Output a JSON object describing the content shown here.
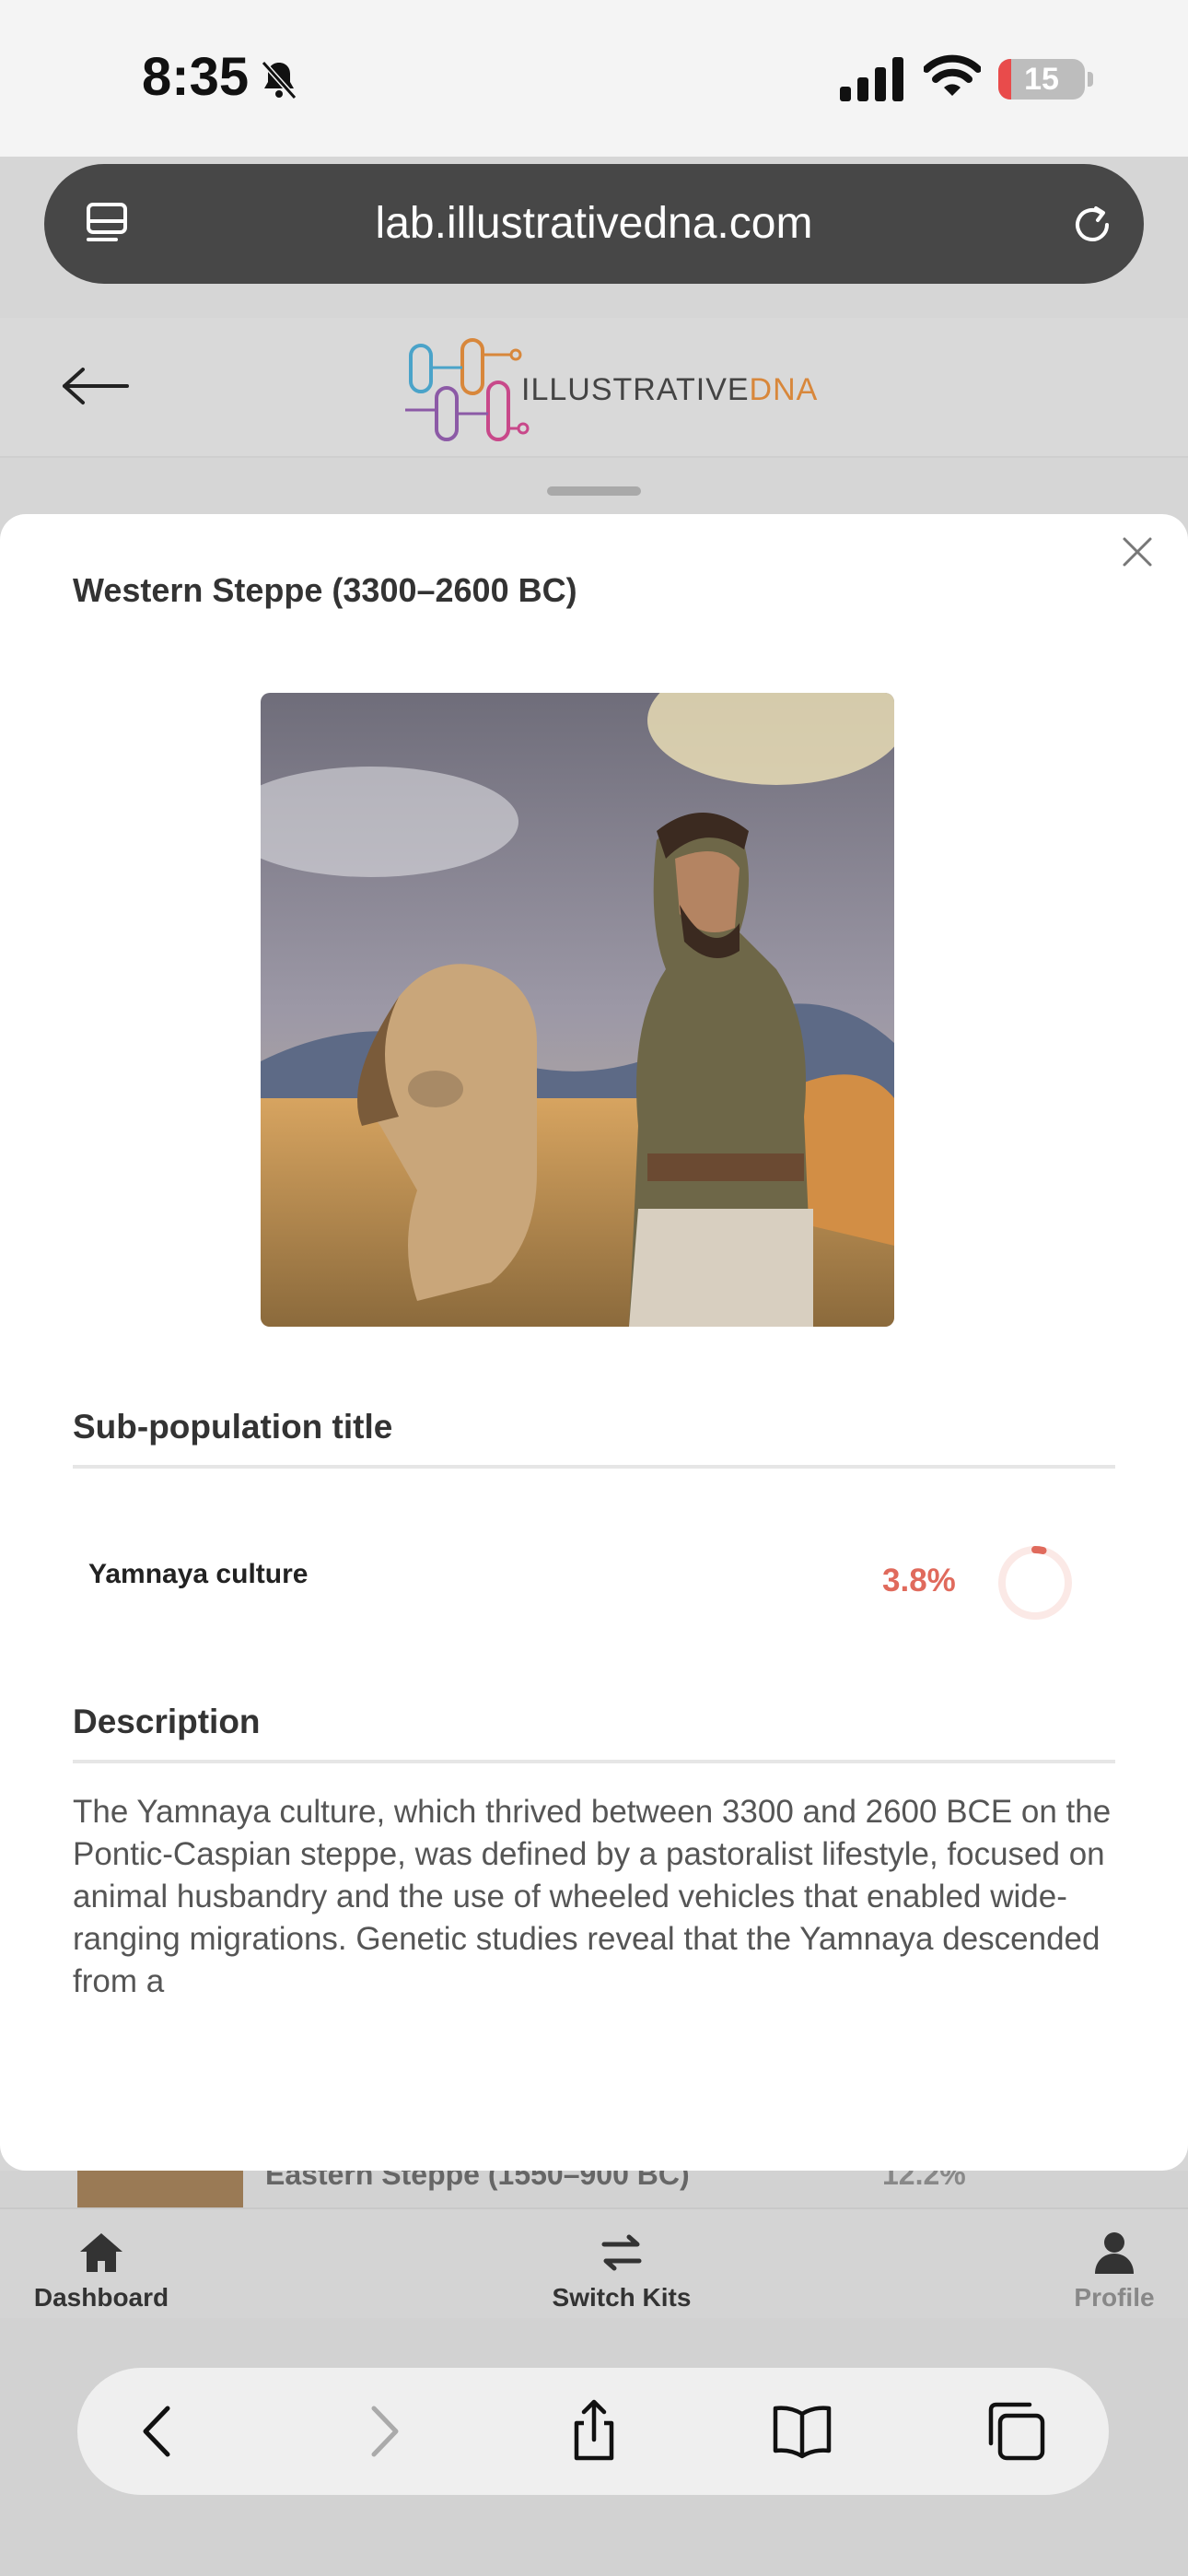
{
  "status_bar": {
    "time": "8:35",
    "battery": "15",
    "battery_level": 0.15,
    "battery_color": "#e94b4b"
  },
  "browser": {
    "url": "lab.illustrativedna.com"
  },
  "site_header": {
    "logo_text_main": "ILLUSTRATIVE",
    "logo_text_accent": "DNA"
  },
  "modal": {
    "title": "Western Steppe (3300–2600 BC)",
    "image_alt": "Illustration of a Yamnaya herder with a horse on the steppe",
    "subpopulation_heading": "Sub-population title",
    "subpopulations": [
      {
        "name": "Yamnaya culture",
        "percent": "3.8%",
        "value": 3.8,
        "color": "#e06a5c"
      }
    ],
    "description_heading": "Description",
    "description": "The Yamnaya culture, which thrived between 3300 and 2600 BCE on the Pontic-Caspian steppe, was defined by a pastoralist lifestyle, focused on animal husbandry and the use of wheeled vehicles that enabled wide-ranging migrations. Genetic studies reveal that the Yamnaya descended from a"
  },
  "background_list_peek": {
    "label": "Eastern Steppe (1550–900 BC)",
    "percent": "12.2%"
  },
  "bottom_nav": [
    {
      "label": "Dashboard",
      "icon": "home-icon"
    },
    {
      "label": "Switch Kits",
      "icon": "switch-arrows-icon"
    },
    {
      "label": "Profile",
      "icon": "person-icon"
    }
  ],
  "safari_toolbar": [
    "back-icon",
    "forward-icon",
    "share-icon",
    "bookmarks-icon",
    "tabs-icon"
  ]
}
